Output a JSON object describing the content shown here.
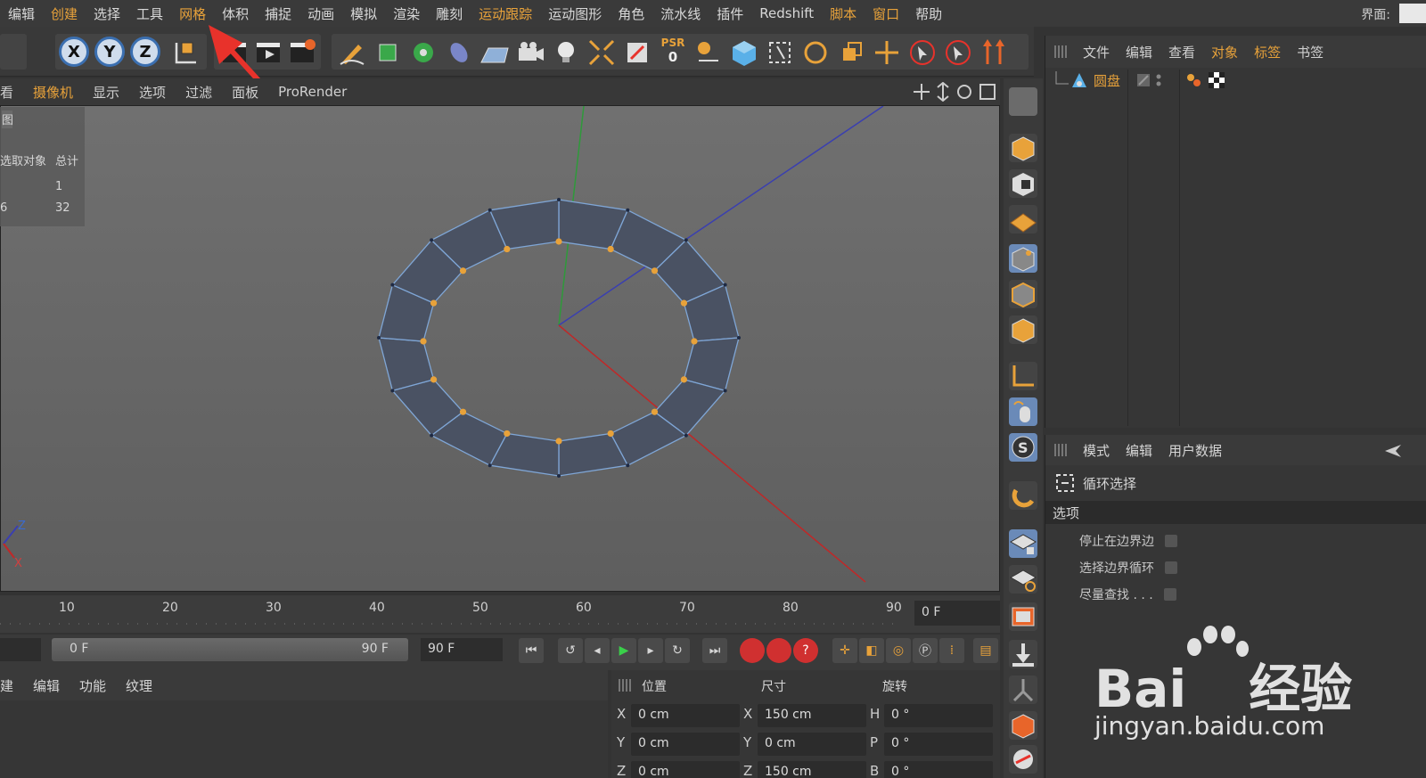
{
  "menubar": {
    "items": [
      "编辑",
      "创建",
      "选择",
      "工具",
      "网格",
      "体积",
      "捕捉",
      "动画",
      "模拟",
      "渲染",
      "雕刻",
      "运动跟踪",
      "运动图形",
      "角色",
      "流水线",
      "插件",
      "Redshift",
      "脚本",
      "窗口",
      "帮助"
    ],
    "layout_label": "界面:"
  },
  "toolbar": {
    "axis_x": "X",
    "axis_y": "Y",
    "axis_z": "Z",
    "psr_label": "PSR",
    "psr_value": "0"
  },
  "viewport_menu": {
    "items": [
      "看",
      "摄像机",
      "显示",
      "选项",
      "过滤",
      "面板",
      "ProRender"
    ]
  },
  "viewport_info": {
    "tab": "图",
    "col_selected": "选取对象",
    "col_total": "总计",
    "row1_total": "1",
    "row2_selected": "6",
    "row2_total": "32"
  },
  "axis_gizmo": {
    "z": "Z",
    "x": "X"
  },
  "object_manager": {
    "menu": [
      "文件",
      "编辑",
      "查看",
      "对象",
      "标签",
      "书签"
    ],
    "object_name": "圆盘"
  },
  "attribute_manager": {
    "menu": [
      "模式",
      "编辑",
      "用户数据"
    ],
    "tool_name": "循环选择",
    "section": "选项",
    "options": [
      "停止在边界边",
      "选择边界循环",
      "尽量查找 . . ."
    ]
  },
  "timeline": {
    "ticks": [
      "10",
      "20",
      "30",
      "40",
      "50",
      "60",
      "70",
      "80",
      "90"
    ],
    "current_frame": "0 F"
  },
  "transport": {
    "range_start": "0 F",
    "range_end": "90 F",
    "end_frame": "90 F"
  },
  "material_menu": {
    "items": [
      "建",
      "编辑",
      "功能",
      "纹理"
    ]
  },
  "coordinates": {
    "headers": [
      "位置",
      "尺寸",
      "旋转"
    ],
    "pos_labels": [
      "X",
      "Y",
      "Z"
    ],
    "pos_values": [
      "0 cm",
      "0 cm",
      "0 cm"
    ],
    "size_labels": [
      "X",
      "Y",
      "Z"
    ],
    "size_values": [
      "150 cm",
      "0 cm",
      "150 cm"
    ],
    "rot_labels": [
      "H",
      "P",
      "B"
    ],
    "rot_values": [
      "0 °",
      "0 °",
      "0 °"
    ]
  },
  "watermark": {
    "brand": "Bai",
    "brand_cn": "经验",
    "url": "jingyan.baidu.com"
  },
  "colors": {
    "accent": "#e8a23a",
    "arrow": "#e8322b",
    "mesh": "#4a5263",
    "axis_blue": "#3b6fb0"
  }
}
